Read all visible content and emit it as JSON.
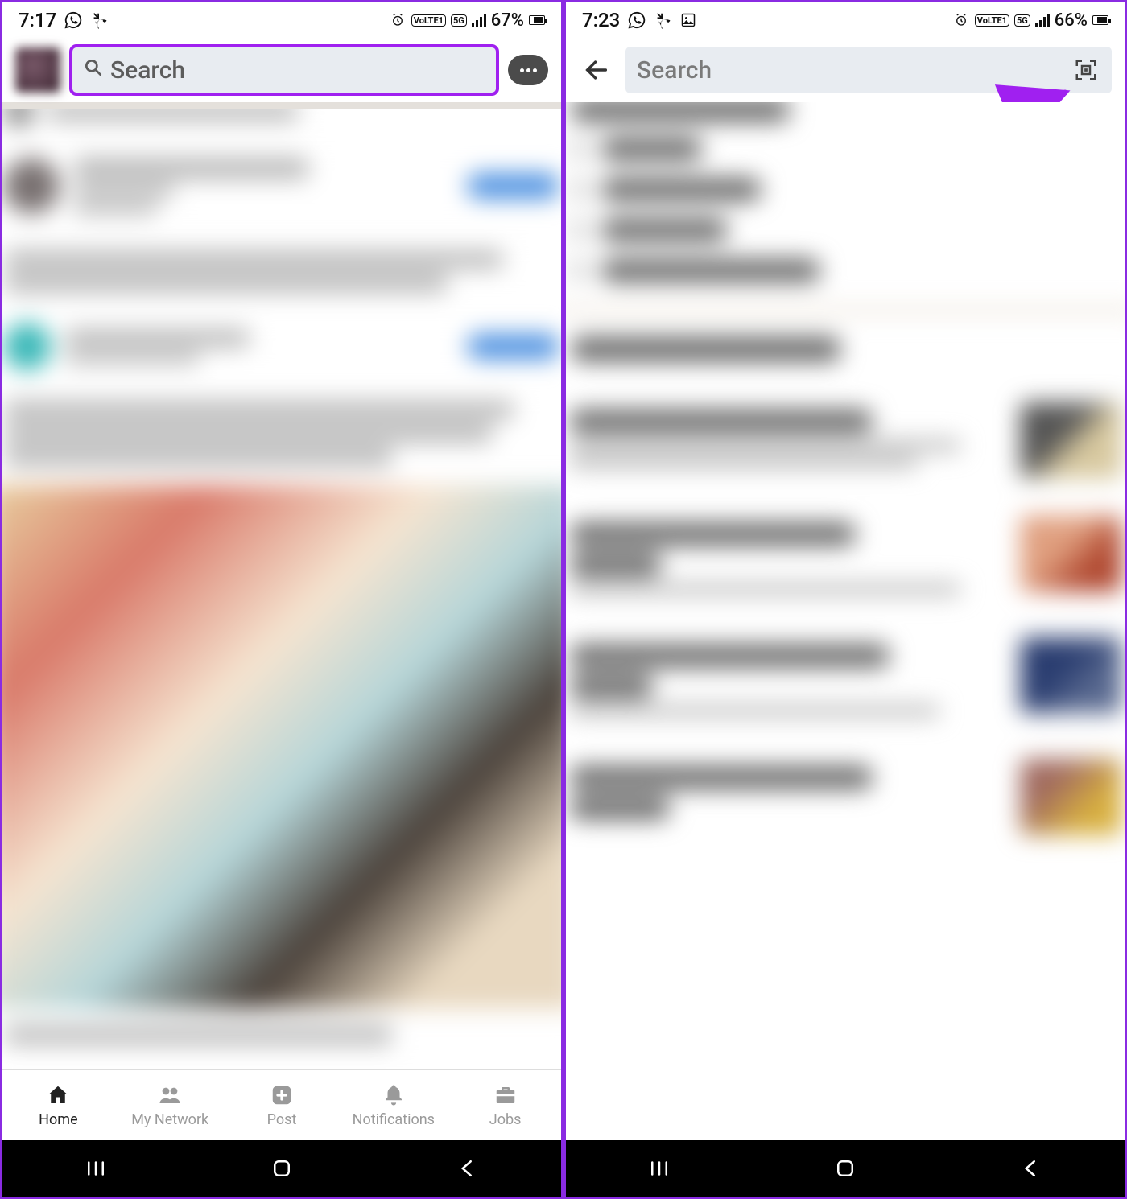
{
  "left": {
    "status": {
      "time": "7:17",
      "battery_pct": "67%"
    },
    "search": {
      "placeholder": "Search"
    },
    "tabs": {
      "home": "Home",
      "network": "My Network",
      "post": "Post",
      "notifications": "Notifications",
      "jobs": "Jobs"
    }
  },
  "right": {
    "status": {
      "time": "7:23",
      "battery_pct": "66%"
    },
    "search": {
      "placeholder": "Search"
    }
  },
  "status_indicators": {
    "volte": "VoLTE1",
    "net": "5G"
  }
}
